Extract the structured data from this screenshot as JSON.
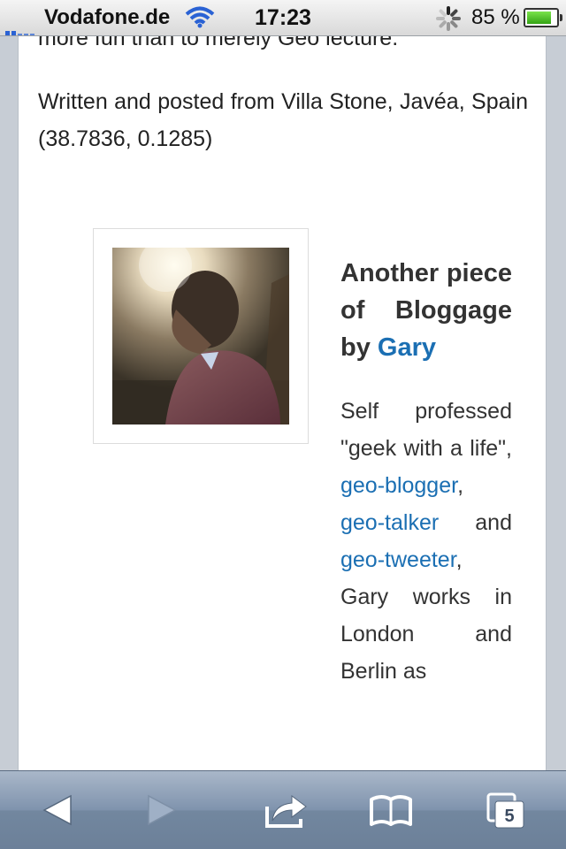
{
  "status": {
    "carrier": "Vodafone.de",
    "time": "17:23",
    "battery": "85 %",
    "battery_level": 0.85
  },
  "article": {
    "clipped_line": "more fun than to merely Geo lecture.",
    "written_prefix": "Written and posted from ",
    "location": "Villa Stone, Javéa, Spain (38.7836, 0.1285)"
  },
  "author": {
    "heading_prefix": "Another piece of Bloggage by ",
    "name": "Gary",
    "bio_prefix": "Self professed \"geek with a life\", ",
    "link1": "geo-blogger",
    "sep1": ", ",
    "link2": "geo-talker",
    "sep2": " and ",
    "link3": "geo-tweeter",
    "bio_suffix": ", Gary works in London and Berlin as"
  },
  "toolbar": {
    "back_icon": "back-arrow",
    "forward_icon": "forward-arrow",
    "share_icon": "share-arrow",
    "bookmarks_icon": "open-book",
    "tabs_icon": "pages",
    "tabs_count": "5"
  }
}
